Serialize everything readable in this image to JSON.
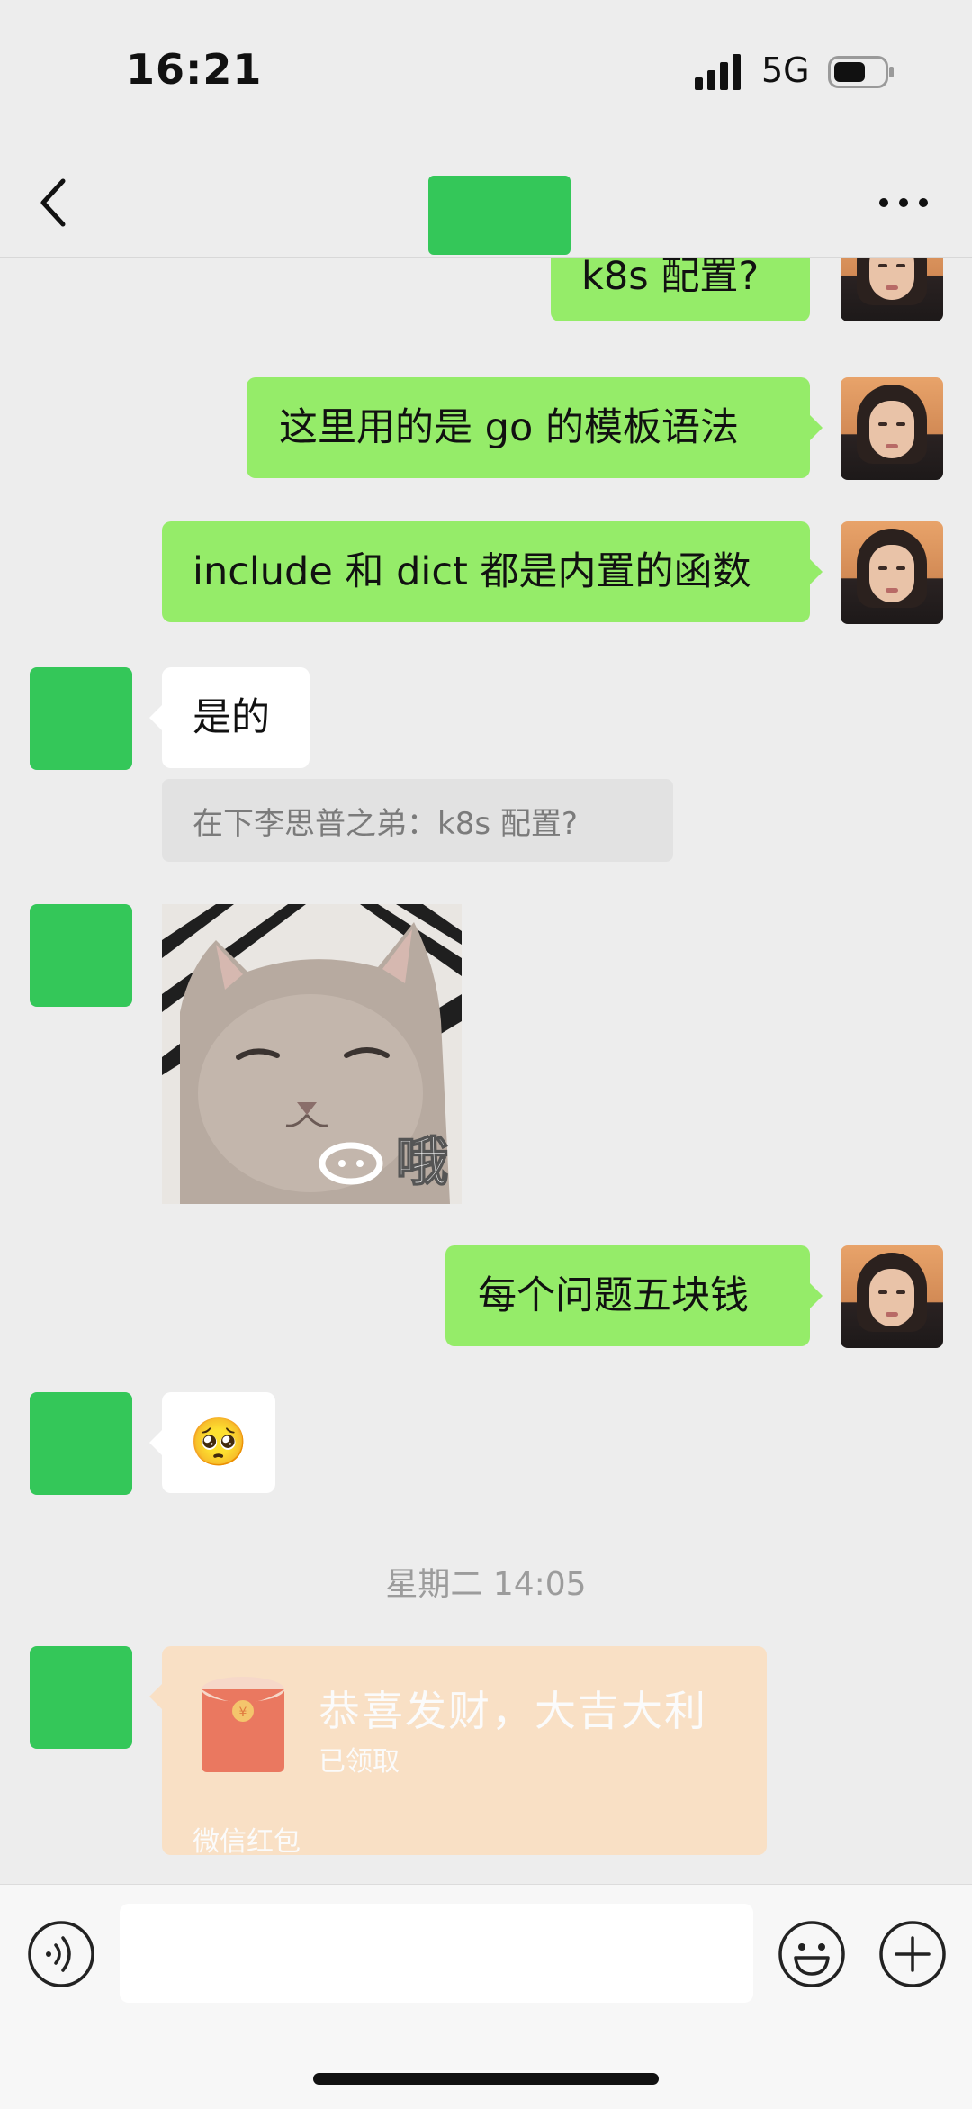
{
  "status_bar": {
    "time": "16:21",
    "network": "5G"
  },
  "nav": {
    "back_icon": "chevron-left-icon",
    "more_icon": "more-horizontal-icon"
  },
  "messages": [
    {
      "from": "me",
      "text": "k8s 配置?"
    },
    {
      "from": "me",
      "text": "这里用的是 go 的模板语法"
    },
    {
      "from": "me",
      "text": "include 和 dict 都是内置的函数"
    },
    {
      "from": "them",
      "text": "是的",
      "quote": "在下李思普之弟：k8s 配置?"
    },
    {
      "from": "them",
      "type": "sticker",
      "caption": "哦"
    },
    {
      "from": "me",
      "text": "每个问题五块钱"
    },
    {
      "from": "them",
      "type": "emoji",
      "text": "🥺"
    }
  ],
  "timestamp": "星期二 14:05",
  "red_packet": {
    "title": "恭喜发财，大吉大利",
    "status": "已领取",
    "brand": "微信红包"
  },
  "input_bar": {
    "voice_icon": "voice-icon",
    "emoji_icon": "emoji-icon",
    "plus_icon": "plus-icon"
  },
  "colors": {
    "my_bubble": "#95ec69",
    "their_bubble": "#ffffff",
    "avatar_placeholder": "#34c759",
    "red_packet_bg": "#f9e0c5",
    "red_packet_icon": "#ea7860"
  }
}
